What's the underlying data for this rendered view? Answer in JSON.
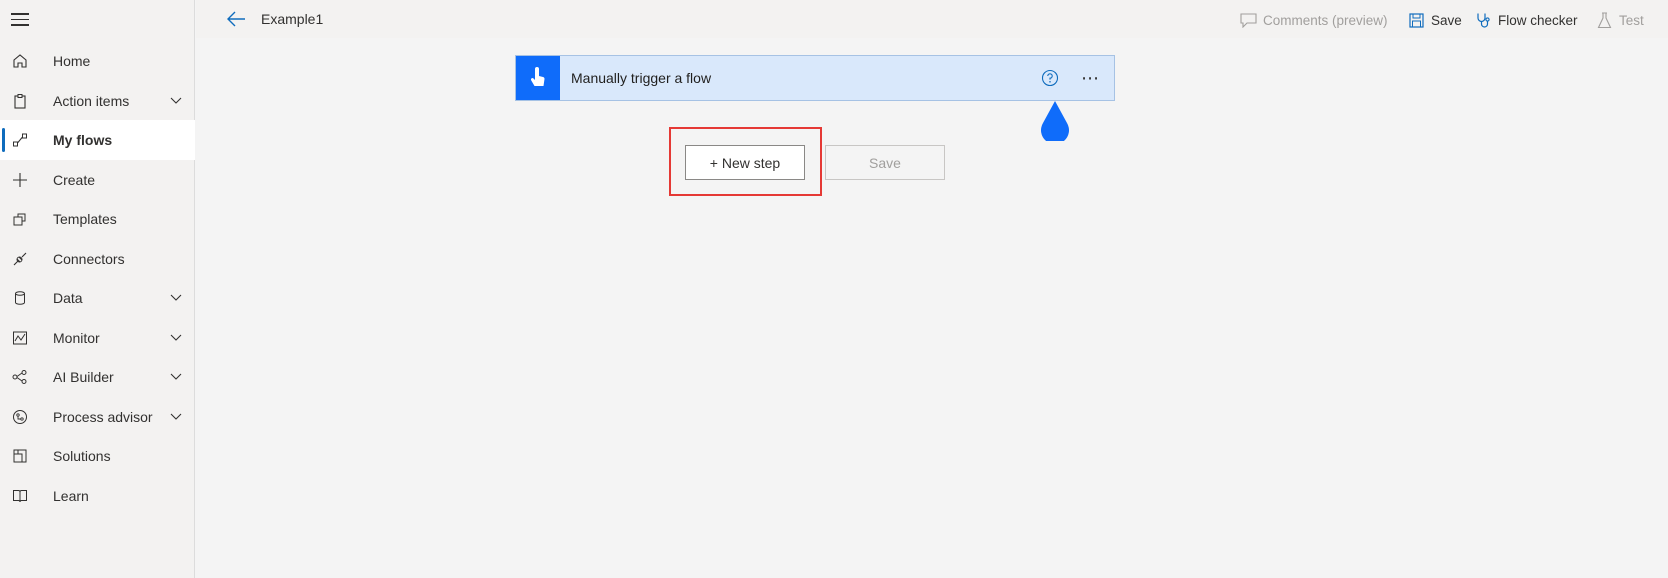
{
  "sidebar": {
    "items": [
      {
        "label": "Home",
        "icon": "home-icon",
        "expandable": false
      },
      {
        "label": "Action items",
        "icon": "clipboard-icon",
        "expandable": true
      },
      {
        "label": "My flows",
        "icon": "flows-icon",
        "expandable": false,
        "active": true
      },
      {
        "label": "Create",
        "icon": "plus-icon",
        "expandable": false
      },
      {
        "label": "Templates",
        "icon": "templates-icon",
        "expandable": false
      },
      {
        "label": "Connectors",
        "icon": "connector-icon",
        "expandable": false
      },
      {
        "label": "Data",
        "icon": "database-icon",
        "expandable": true
      },
      {
        "label": "Monitor",
        "icon": "monitor-icon",
        "expandable": true
      },
      {
        "label": "AI Builder",
        "icon": "ai-builder-icon",
        "expandable": true
      },
      {
        "label": "Process advisor",
        "icon": "process-advisor-icon",
        "expandable": true
      },
      {
        "label": "Solutions",
        "icon": "solutions-icon",
        "expandable": false
      },
      {
        "label": "Learn",
        "icon": "book-icon",
        "expandable": false
      }
    ]
  },
  "topbar": {
    "title": "Example1",
    "commands": {
      "comments": "Comments (preview)",
      "save": "Save",
      "flow_checker": "Flow checker",
      "test": "Test"
    }
  },
  "canvas": {
    "trigger": {
      "title": "Manually trigger a flow"
    },
    "new_step_label": "+ New step",
    "save_label": "Save"
  },
  "colors": {
    "accent": "#0f6cfa",
    "trigger_bg": "#d9e8fb",
    "highlight": "#e53935"
  }
}
